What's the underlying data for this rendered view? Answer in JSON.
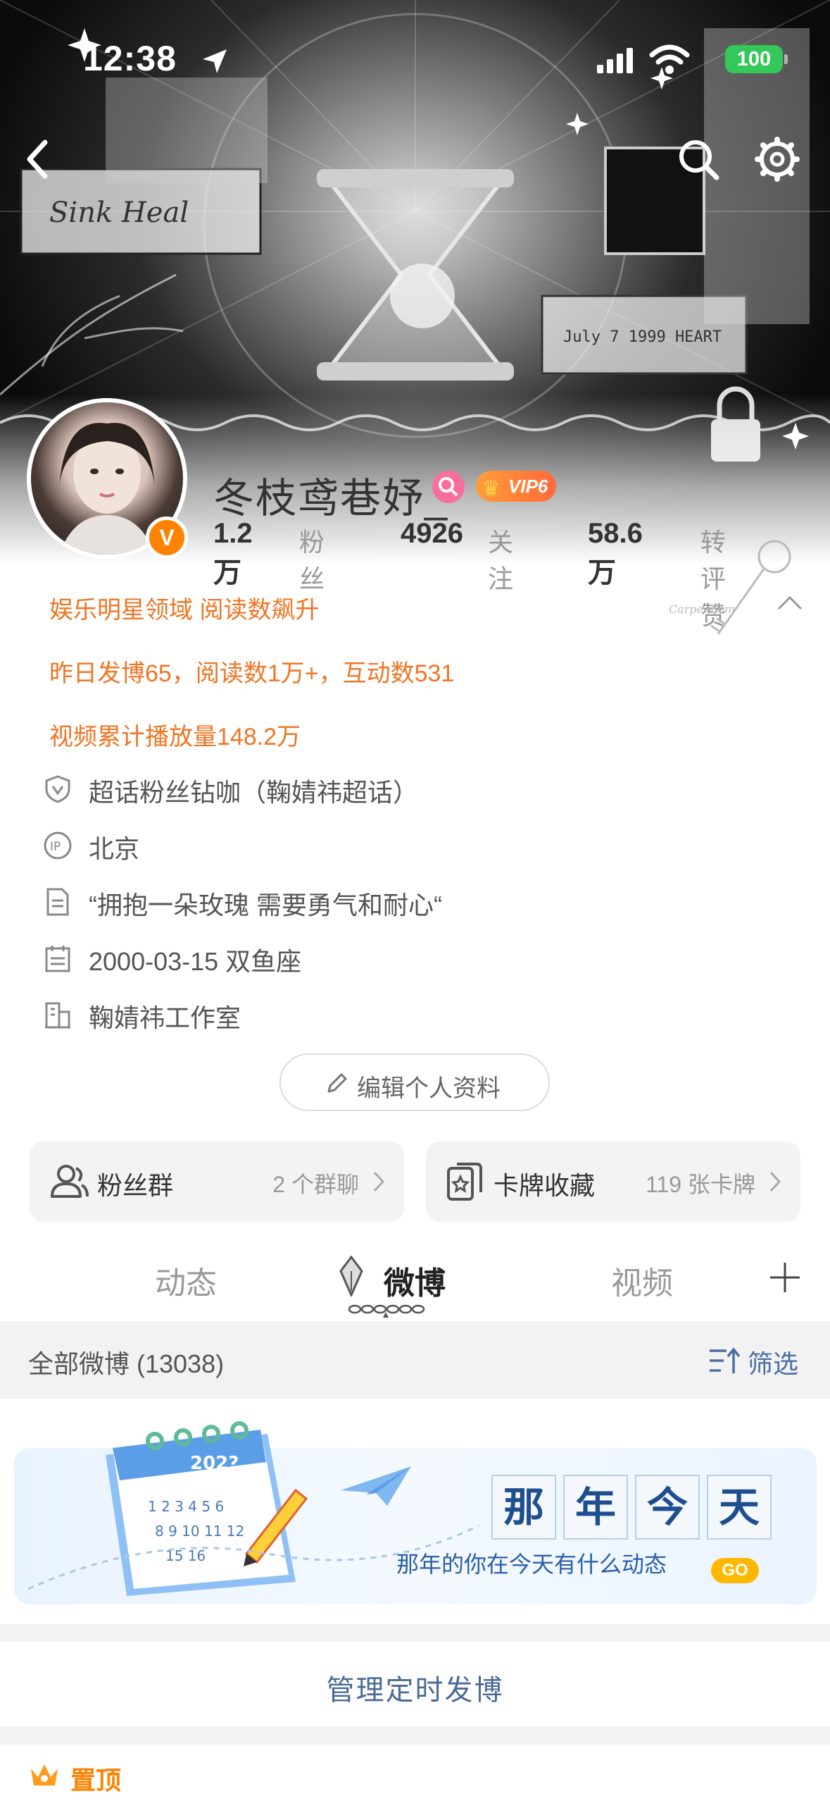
{
  "status_bar": {
    "time": "12:38",
    "battery": "100"
  },
  "profile": {
    "username": "冬枝鸢巷妤_",
    "vip_level": "VIP6",
    "verified_badge": "V",
    "stats": [
      {
        "value": "1.2万",
        "label": "粉丝"
      },
      {
        "value": "4926",
        "label": "关注"
      },
      {
        "value": "58.6万",
        "label": "转评赞"
      }
    ]
  },
  "highlights": [
    "娱乐明星领域 阅读数飙升",
    "昨日发博65，阅读数1万+，互动数531",
    "视频累计播放量148.2万"
  ],
  "info_items": [
    {
      "icon": "shield-v-icon",
      "text": "超话粉丝钻咖（鞠婧祎超话）"
    },
    {
      "icon": "ip-icon",
      "text": "北京"
    },
    {
      "icon": "document-icon",
      "text": "“拥抱一朵玫瑰 需要勇气和耐心“"
    },
    {
      "icon": "calendar-icon",
      "text": "2000-03-15 双鱼座"
    },
    {
      "icon": "building-icon",
      "text": "鞠婧祎工作室"
    }
  ],
  "edit_profile_label": "编辑个人资料",
  "cards": [
    {
      "icon": "fans-group-icon",
      "title": "粉丝群",
      "meta": "2 个群聊"
    },
    {
      "icon": "card-collection-icon",
      "title": "卡牌收藏",
      "meta": "119 张卡牌"
    }
  ],
  "tabs": [
    {
      "label": "动态",
      "active": false
    },
    {
      "label": "微博",
      "active": true
    },
    {
      "label": "视频",
      "active": false
    }
  ],
  "filter": {
    "all_label": "全部微博 (13038)",
    "filter_label": "筛选"
  },
  "banner": {
    "title_chars": [
      "那",
      "年",
      "今",
      "天"
    ],
    "subtitle": "那年的你在今天有什么动态",
    "go_label": "GO",
    "calendar_year": "202?"
  },
  "manage_label": "管理定时发博",
  "pinned_label": "置顶",
  "colors": {
    "accent_orange": "#f07523",
    "weibo_orange": "#ff8200",
    "link_blue": "#4a6a96",
    "battery_green": "#34c759"
  }
}
